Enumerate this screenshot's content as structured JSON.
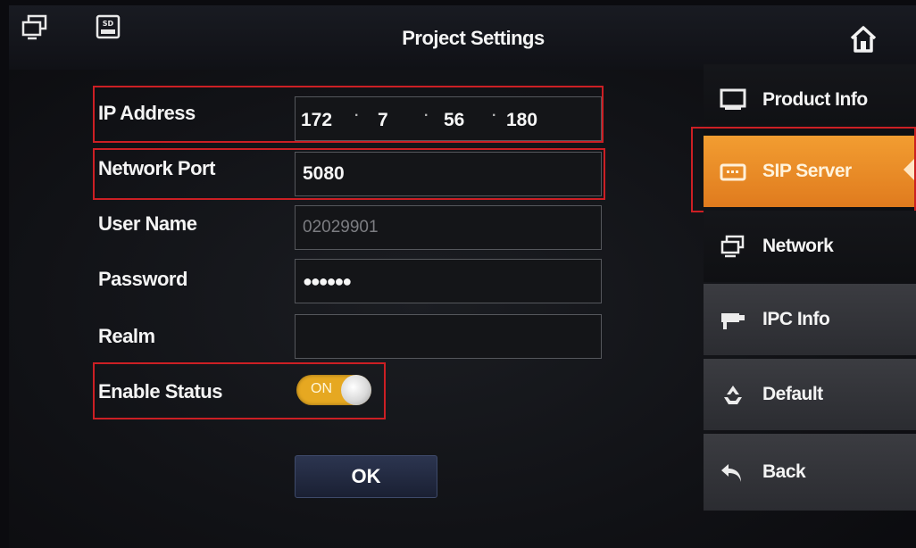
{
  "header": {
    "title": "Project Settings"
  },
  "form": {
    "ip_label": "IP Address",
    "ip_octets": [
      "172",
      "7",
      "56",
      "180"
    ],
    "port_label": "Network Port",
    "port_value": "5080",
    "user_label": "User Name",
    "user_value": "02029901",
    "password_label": "Password",
    "password_value": "●●●●●●",
    "realm_label": "Realm",
    "realm_value": "",
    "enable_label": "Enable Status",
    "enable_toggle": "ON",
    "ok_label": "OK"
  },
  "sidebar": {
    "items": [
      {
        "label": "Product Info",
        "icon": "monitor-icon"
      },
      {
        "label": "SIP Server",
        "icon": "server-icon",
        "active": true
      },
      {
        "label": "Network",
        "icon": "network-icon"
      },
      {
        "label": "IPC Info",
        "icon": "camera-icon"
      },
      {
        "label": "Default",
        "icon": "recycle-icon"
      },
      {
        "label": "Back",
        "icon": "back-arrow-icon"
      }
    ]
  },
  "colors": {
    "accent": "#f29d31",
    "highlight": "#cc1f24",
    "toggle_on": "#e6a821"
  }
}
